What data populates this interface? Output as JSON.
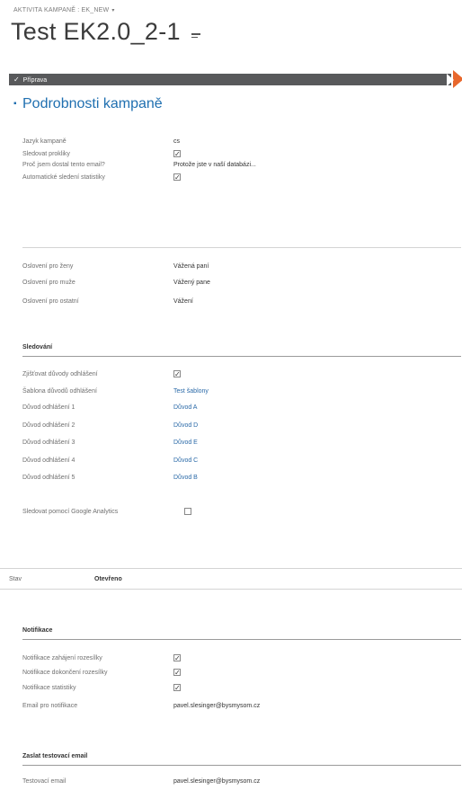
{
  "header": {
    "entity_label": "AKTIVITA KAMPANĚ : EK_NEW",
    "entity_caret": "▾",
    "title": "Test EK2.0_2-1"
  },
  "process": {
    "stage_label": "Příprava",
    "stage_check": "✓",
    "arrow_color": "#e8672c"
  },
  "section": {
    "bullet": "▪",
    "title": "Podrobnosti kampaně"
  },
  "details": [
    {
      "label": "Jazyk kampaně",
      "value": "cs",
      "type": "text"
    },
    {
      "label": "Sledovat prokliky",
      "value": "",
      "type": "checkbox",
      "checked": true
    },
    {
      "label": "Proč jsem dostal tento email?",
      "value": "Protože jste v naší databázi...",
      "type": "text"
    },
    {
      "label": "Automatické sledení statistiky",
      "value": "",
      "type": "checkbox",
      "checked": true
    }
  ],
  "salutation": [
    {
      "label": "Oslovení pro ženy",
      "value": "Vážená paní"
    },
    {
      "label": "Oslovení pro muže",
      "value": "Vážený pane"
    },
    {
      "label": "Oslovení pro ostatní",
      "value": "Vážení"
    }
  ],
  "tracking": {
    "heading": "Sledování",
    "rows": [
      {
        "label": "Zjišťovat důvody odhlášení",
        "value": "",
        "type": "checkbox",
        "checked": true
      },
      {
        "label": "Šablona důvodů odhlášení",
        "value": "Test šablony",
        "type": "link"
      },
      {
        "label": "Důvod odhlášení 1",
        "value": "Důvod A",
        "type": "link"
      },
      {
        "label": "Důvod odhlášení 2",
        "value": "Důvod D",
        "type": "link"
      },
      {
        "label": "Důvod odhlášení 3",
        "value": "Důvod E",
        "type": "link"
      },
      {
        "label": "Důvod odhlášení 4",
        "value": "Důvod C",
        "type": "link"
      },
      {
        "label": "Důvod odhlášení 5",
        "value": "Důvod B",
        "type": "link"
      }
    ],
    "ga_label": "Sledovat pomocí Google Analytics",
    "ga_checked": false
  },
  "status": {
    "label": "Stav",
    "value": "Otevřeno"
  },
  "notifications": {
    "heading": "Notifikace",
    "rows": [
      {
        "label": "Notifikace zahájení rozesílky",
        "type": "checkbox",
        "checked": true
      },
      {
        "label": "Notifikace dokončení rozesílky",
        "type": "checkbox",
        "checked": true
      },
      {
        "label": "Notifikace statistiky",
        "type": "checkbox",
        "checked": true
      },
      {
        "label": "Email pro notifikace",
        "type": "text",
        "value": "pavel.slesinger@bysmysom.cz"
      }
    ]
  },
  "test_email": {
    "heading": "Zaslat testovací email",
    "label": "Testovací email",
    "value": "pavel.slesinger@bysmysom.cz"
  }
}
